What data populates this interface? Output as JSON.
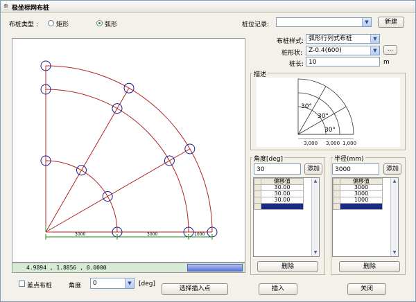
{
  "window": {
    "title": "极坐标网布桩"
  },
  "top": {
    "type_label": "布桩类型 :",
    "radio_rect": "矩形",
    "radio_arc": "弧形",
    "record_label": "桩位记录:",
    "new_button": "新建"
  },
  "form": {
    "style_label": "布桩样式:",
    "style_value": "弧形行列式布桩",
    "shape_label": "桩形状:",
    "shape_value": "Z-0.4(600)",
    "browse_button": "...",
    "length_label": "桩长:",
    "length_value": "10",
    "length_unit": "m"
  },
  "desc": {
    "label": "描述",
    "angles": [
      "30°",
      "30°",
      "30°"
    ],
    "radii": [
      "3,000",
      "3,000",
      "1,000"
    ]
  },
  "angle_panel": {
    "label": "角度[deg]",
    "input": "30",
    "add_button": "添加",
    "header": "偏移值",
    "rows": [
      "30.00",
      "30.00",
      "30.00"
    ],
    "delete_button": "删除"
  },
  "radius_panel": {
    "label": "半径(mm)",
    "input": "3000",
    "add_button": "添加",
    "header": "偏移值",
    "rows": [
      "3000",
      "3000",
      "1000"
    ],
    "delete_button": "删除"
  },
  "canvas": {
    "dims": [
      "3000",
      "3000",
      "1000"
    ],
    "status": "4.9894 , 1.8856 , 0.0000"
  },
  "bottom": {
    "diff_checkbox": "差点布桩",
    "angle_label": "角度",
    "angle_value": "0",
    "angle_unit": "[deg]",
    "select_point_button": "选择插入点",
    "insert_button": "插入",
    "close_button": "关闭"
  },
  "colors": {
    "arc": "#b22222",
    "pile": "#1a1a8a",
    "dim": "#1a8a1a"
  }
}
